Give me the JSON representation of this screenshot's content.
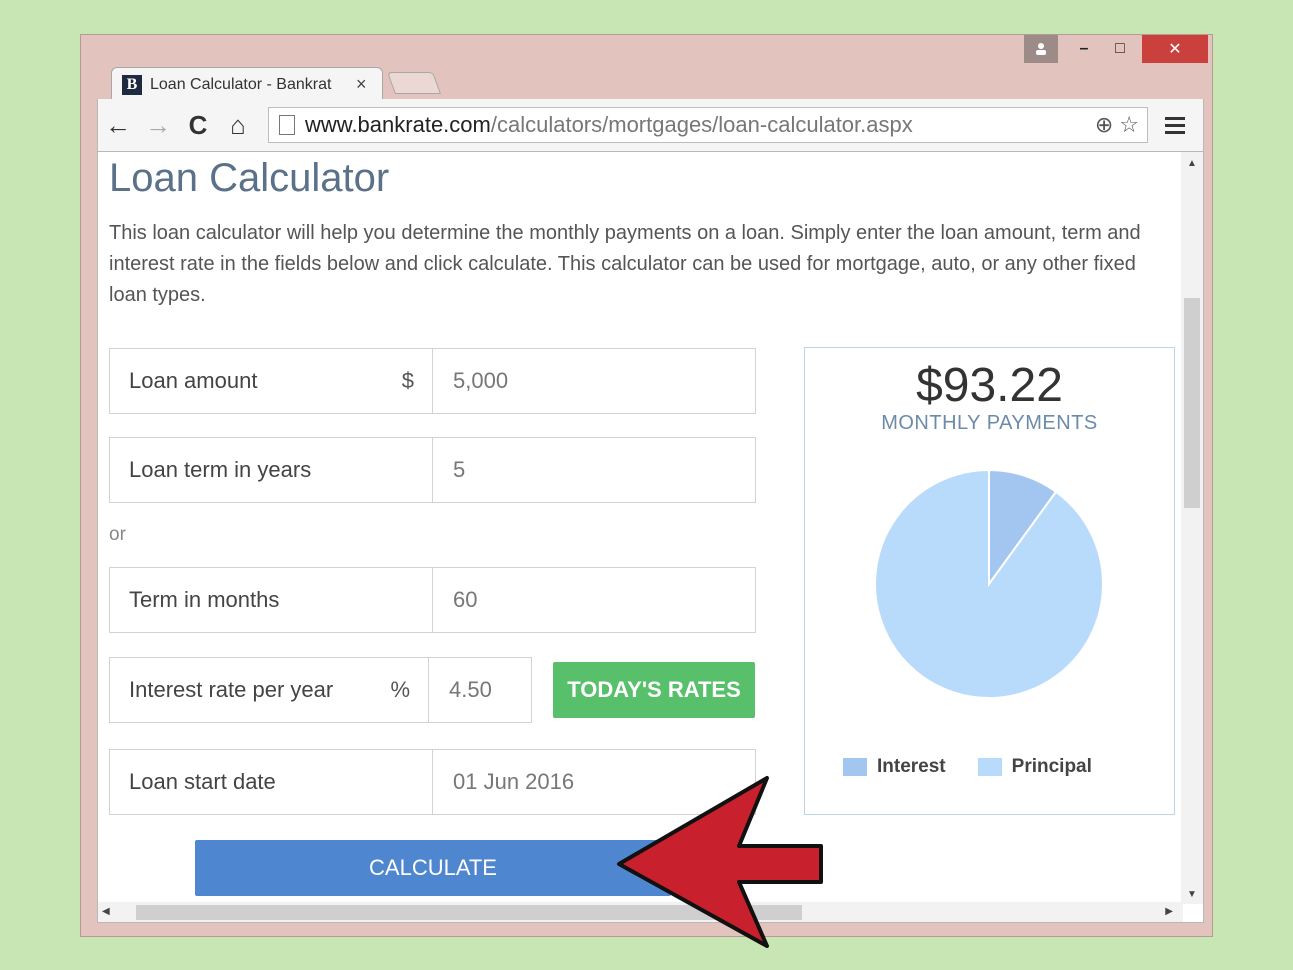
{
  "tab": {
    "favicon": "B",
    "title": "Loan Calculator - Bankrat",
    "close": "×"
  },
  "toolbar": {
    "back": "←",
    "forward": "→",
    "reload": "C",
    "home": "⌂",
    "url_host": "www.bankrate.com",
    "url_path": "/calculators/mortgages/loan-calculator.aspx",
    "zoom": "⊕",
    "star": "☆"
  },
  "window_controls": {
    "user": "👤",
    "minimize": "–",
    "maximize": "□",
    "close": "✕"
  },
  "page": {
    "title": "Loan Calculator",
    "intro": "This loan calculator will help you determine the monthly payments on a loan. Simply enter the loan amount, term and interest rate in the fields below and click calculate. This calculator can be used for mortgage, auto, or any other fixed loan types."
  },
  "form": {
    "loan_amount": {
      "label": "Loan amount",
      "symbol": "$",
      "value": "5,000"
    },
    "loan_term": {
      "label": "Loan term in years",
      "value": "5"
    },
    "or": "or",
    "term_months": {
      "label": "Term in months",
      "value": "60"
    },
    "interest_rate": {
      "label": "Interest rate per year",
      "symbol": "%",
      "value": "4.50"
    },
    "start_date": {
      "label": "Loan start date",
      "value": "01 Jun 2016"
    },
    "todays_rates_button": "TODAY'S RATES",
    "calculate_button": "CALCULATE"
  },
  "result": {
    "monthly_payment": "$93.22",
    "label": "MONTHLY PAYMENTS"
  },
  "chart_data": {
    "type": "pie",
    "slices": [
      {
        "name": "Interest",
        "fraction": 0.1,
        "color": "#a3c6f0"
      },
      {
        "name": "Principal",
        "fraction": 0.9,
        "color": "#b9dbfb"
      }
    ]
  },
  "colors": {
    "accent_green": "#58c06a",
    "accent_blue": "#4e86d0",
    "arrow_red": "#c8202c"
  }
}
